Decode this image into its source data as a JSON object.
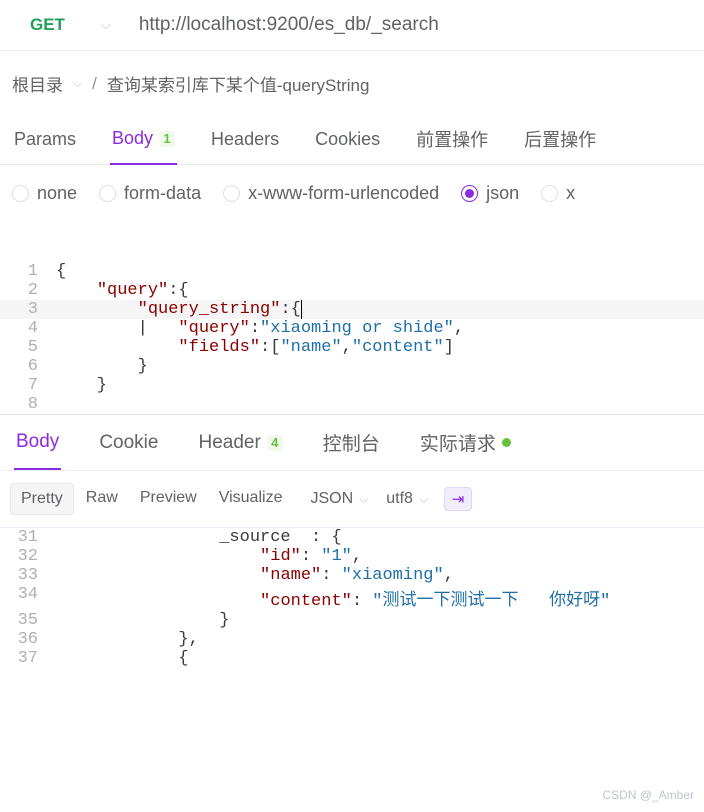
{
  "request": {
    "method": "GET",
    "url": "http://localhost:9200/es_db/_search"
  },
  "breadcrumbs": {
    "root": "根目录",
    "separator": "/",
    "current": "查询某索引库下某个值-queryString"
  },
  "tabs": [
    {
      "label": "Params"
    },
    {
      "label": "Body",
      "badge": "1",
      "active": true
    },
    {
      "label": "Headers"
    },
    {
      "label": "Cookies"
    },
    {
      "label": "前置操作"
    },
    {
      "label": "后置操作"
    }
  ],
  "bodyTypes": [
    {
      "label": "none"
    },
    {
      "label": "form-data"
    },
    {
      "label": "x-www-form-urlencoded"
    },
    {
      "label": "json",
      "selected": true
    },
    {
      "label": "x"
    }
  ],
  "requestBody": {
    "lines": [
      {
        "n": "1",
        "segs": [
          {
            "t": "{",
            "c": "p"
          }
        ]
      },
      {
        "n": "2",
        "segs": [
          {
            "t": "    ",
            "c": ""
          },
          {
            "t": "\"query\"",
            "c": "k"
          },
          {
            "t": ":{",
            "c": "p"
          }
        ]
      },
      {
        "n": "3",
        "hl": true,
        "segs": [
          {
            "t": "        ",
            "c": ""
          },
          {
            "t": "\"query_string\"",
            "c": "k"
          },
          {
            "t": ":{",
            "c": "p cursor"
          }
        ]
      },
      {
        "n": "4",
        "segs": [
          {
            "t": "        |   ",
            "c": ""
          },
          {
            "t": "\"query\"",
            "c": "k"
          },
          {
            "t": ":",
            "c": "p"
          },
          {
            "t": "\"xiaoming or shide\"",
            "c": "s"
          },
          {
            "t": ",",
            "c": "p"
          }
        ]
      },
      {
        "n": "5",
        "segs": [
          {
            "t": "            ",
            "c": ""
          },
          {
            "t": "\"fields\"",
            "c": "k"
          },
          {
            "t": ":[",
            "c": "p"
          },
          {
            "t": "\"name\"",
            "c": "s"
          },
          {
            "t": ",",
            "c": "p"
          },
          {
            "t": "\"content\"",
            "c": "s"
          },
          {
            "t": "]",
            "c": "p"
          }
        ]
      },
      {
        "n": "6",
        "segs": [
          {
            "t": "        }",
            "c": "p"
          }
        ]
      },
      {
        "n": "7",
        "segs": [
          {
            "t": "    }",
            "c": "p"
          }
        ]
      },
      {
        "n": "8",
        "segs": [
          {
            "t": " ",
            "c": ""
          }
        ]
      }
    ]
  },
  "respTabs": [
    {
      "label": "Body",
      "active": true
    },
    {
      "label": "Cookie"
    },
    {
      "label": "Header",
      "badge": "4"
    },
    {
      "label": "控制台"
    },
    {
      "label": "实际请求",
      "dot": true
    }
  ],
  "viewModes": [
    {
      "label": "Pretty",
      "active": true
    },
    {
      "label": "Raw"
    },
    {
      "label": "Preview"
    },
    {
      "label": "Visualize"
    }
  ],
  "format": {
    "type": "JSON",
    "enc": "utf8"
  },
  "responseBody": {
    "lines": [
      {
        "n": "31",
        "segs": [
          {
            "t": "                _source  : {",
            "c": "p"
          }
        ]
      },
      {
        "n": "32",
        "segs": [
          {
            "t": "                    ",
            "c": ""
          },
          {
            "t": "\"id\"",
            "c": "k"
          },
          {
            "t": ": ",
            "c": "p"
          },
          {
            "t": "\"1\"",
            "c": "s"
          },
          {
            "t": ",",
            "c": "p"
          }
        ]
      },
      {
        "n": "33",
        "segs": [
          {
            "t": "                    ",
            "c": ""
          },
          {
            "t": "\"name\"",
            "c": "k"
          },
          {
            "t": ": ",
            "c": "p"
          },
          {
            "t": "\"xiaoming\"",
            "c": "s"
          },
          {
            "t": ",",
            "c": "p"
          }
        ]
      },
      {
        "n": "34",
        "segs": [
          {
            "t": "                    ",
            "c": ""
          },
          {
            "t": "\"content\"",
            "c": "k"
          },
          {
            "t": ": ",
            "c": "p"
          },
          {
            "t": "\"测试一下测试一下   你好呀\"",
            "c": "s"
          }
        ]
      },
      {
        "n": "35",
        "segs": [
          {
            "t": "                }",
            "c": "p"
          }
        ]
      },
      {
        "n": "36",
        "segs": [
          {
            "t": "            },",
            "c": "p"
          }
        ]
      },
      {
        "n": "37",
        "segs": [
          {
            "t": "            {",
            "c": "p"
          }
        ]
      }
    ]
  },
  "watermark": "CSDN @_Amber"
}
